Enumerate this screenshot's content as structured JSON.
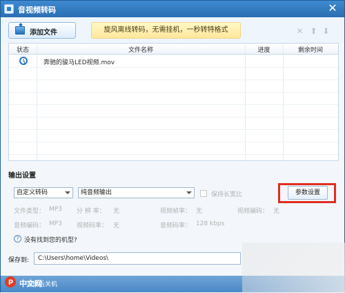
{
  "window": {
    "title": "音视频转码",
    "close_glyph": "✕"
  },
  "toolbar": {
    "add_file_label": "添加文件",
    "promo_text": "旋风离线转码，无需挂机，一秒转特格式",
    "icons": [
      "close-icon",
      "arrow-up-icon",
      "arrow-down-icon"
    ]
  },
  "table": {
    "headers": [
      "状态",
      "文件名称",
      "进度",
      "剩余时间"
    ],
    "rows": [
      {
        "status_icon": "clock-icon",
        "name": "奔驰的骏马LED视频.mov",
        "progress": "",
        "remaining": ""
      }
    ]
  },
  "output": {
    "section_title": "输出设置",
    "format_select": "自定义转码",
    "audio_select": "纯音频输出",
    "keep_ratio_label": "保持长宽比",
    "params_button": "参数设置",
    "info": [
      [
        "文件类型：",
        "MP3",
        "分 辨 率：",
        "无",
        "视频帧率：",
        "无",
        "视频编码：",
        "无"
      ],
      [
        "音频编码：",
        "MP3",
        "视频码率：",
        "无",
        "音频码率：",
        "128 kbps"
      ]
    ],
    "help_text": "没有找到您的机型?",
    "save_label": "保存到:",
    "save_path": "C:\\Users\\home\\Videos\\"
  },
  "footer": {
    "text": "完成后关机"
  },
  "watermark": {
    "text": "中文网"
  },
  "colors": {
    "title_bar": "#2f78c2",
    "highlight_box": "#df2d20",
    "promo_bg": "#ffe79c"
  }
}
